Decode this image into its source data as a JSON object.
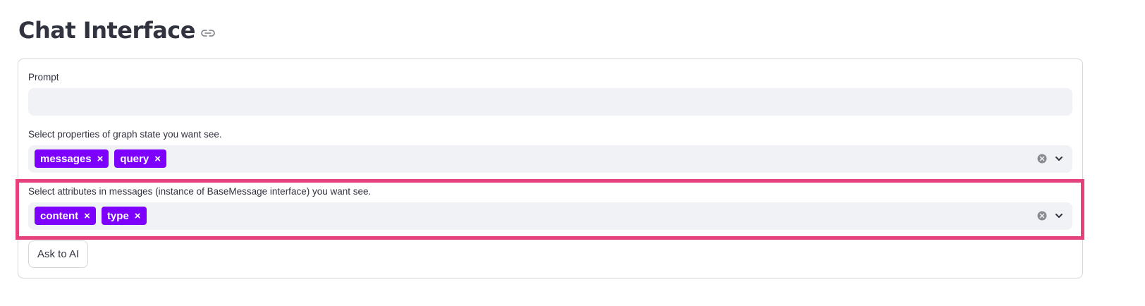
{
  "header": {
    "title": "Chat Interface",
    "link_icon": "link-icon"
  },
  "prompt": {
    "label": "Prompt",
    "value": "",
    "placeholder": ""
  },
  "graph_state_select": {
    "label": "Select properties of graph state you want see.",
    "selected": [
      "messages",
      "query"
    ],
    "remove_glyph": "×",
    "clear_icon": "clear-icon",
    "dropdown_icon": "chevron-down-icon"
  },
  "message_attr_select": {
    "label": "Select attributes in messages (instance of BaseMessage interface) you want see.",
    "selected": [
      "content",
      "type"
    ],
    "remove_glyph": "×",
    "clear_icon": "clear-icon",
    "dropdown_icon": "chevron-down-icon"
  },
  "submit": {
    "label": "Ask to AI"
  },
  "colors": {
    "tag": "#7d00ff",
    "highlight": "#e5417c",
    "input_bg": "#f0f2f6",
    "text": "#31333f"
  }
}
